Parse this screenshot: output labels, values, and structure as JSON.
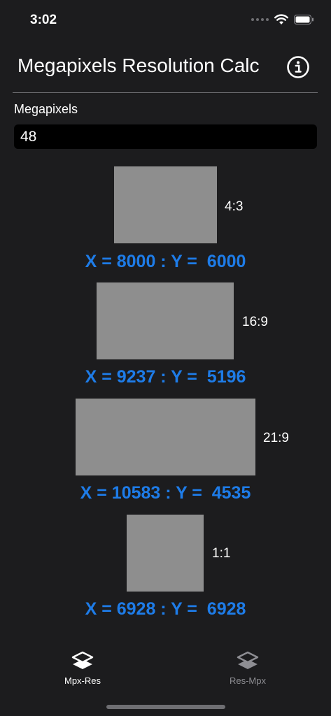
{
  "status_bar": {
    "time": "3:02"
  },
  "header": {
    "title": "Megapixels Resolution Calc",
    "info_icon": "info-circle-icon"
  },
  "input": {
    "label": "Megapixels",
    "value": "48"
  },
  "ratios": [
    {
      "label": "4:3",
      "result": "X = 8000 : Y =  6000"
    },
    {
      "label": "16:9",
      "result": "X = 9237 : Y =  5196"
    },
    {
      "label": "21:9",
      "result": "X = 10583 : Y =  4535"
    },
    {
      "label": "1:1",
      "result": "X = 6928 : Y =  6928"
    }
  ],
  "tab_bar": {
    "tabs": [
      {
        "label": "Mpx-Res",
        "icon": "layers-icon",
        "selected": true
      },
      {
        "label": "Res-Mpx",
        "icon": "layers-icon",
        "selected": false
      }
    ]
  },
  "colors": {
    "background": "#1c1c1e",
    "accent_result": "#1e7ce8",
    "rect_fill": "#8e8e8e",
    "tab_active": "#ffffff",
    "tab_inactive": "#8e8e93"
  }
}
